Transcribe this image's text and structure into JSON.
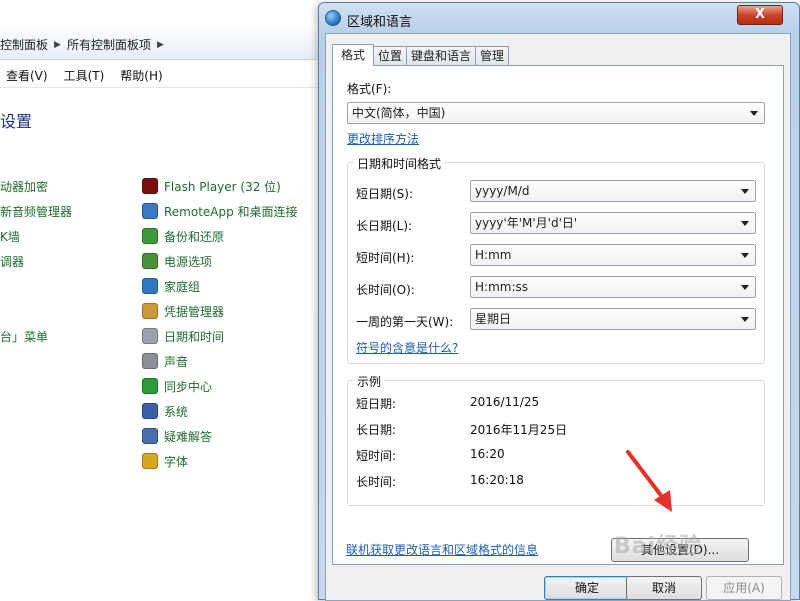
{
  "control_panel": {
    "breadcrumb": [
      "控制面板",
      "所有控制面板项"
    ],
    "menu": [
      "查看(V)",
      "工具(T)",
      "帮助(H)"
    ],
    "title": "设置",
    "left_items": [
      "动器加密",
      "新音频管理器",
      "K墙",
      "调器",
      "台」菜单"
    ],
    "right_items": [
      {
        "label": "Flash Player (32 位)",
        "icon": "flash-icon",
        "color": "#7a1010"
      },
      {
        "label": "RemoteApp 和桌面连接",
        "icon": "remote-desktop-icon",
        "color": "#3a78c3"
      },
      {
        "label": "备份和还原",
        "icon": "backup-icon",
        "color": "#3f9a3b"
      },
      {
        "label": "电源选项",
        "icon": "power-icon",
        "color": "#4e8f3a"
      },
      {
        "label": "家庭组",
        "icon": "homegroup-icon",
        "color": "#2f78c0"
      },
      {
        "label": "凭据管理器",
        "icon": "credential-icon",
        "color": "#c89a3a"
      },
      {
        "label": "日期和时间",
        "icon": "clock-icon",
        "color": "#9aa3ad"
      },
      {
        "label": "声音",
        "icon": "speaker-icon",
        "color": "#8b8f96"
      },
      {
        "label": "同步中心",
        "icon": "sync-icon",
        "color": "#2c9a3a"
      },
      {
        "label": "系统",
        "icon": "system-icon",
        "color": "#3a5fa8"
      },
      {
        "label": "疑难解答",
        "icon": "troubleshoot-icon",
        "color": "#4a6fb0"
      },
      {
        "label": "字体",
        "icon": "font-icon",
        "color": "#d9a520"
      }
    ]
  },
  "dialog": {
    "title": "区域和语言",
    "close_label": "X",
    "tabs": [
      "格式",
      "位置",
      "键盘和语言",
      "管理"
    ],
    "format_label": "格式(F):",
    "format_value": "中文(简体，中国)",
    "sort_link": "更改排序方法",
    "datetime_group_title": "日期和时间格式",
    "fields": [
      {
        "label": "短日期(S):",
        "value": "yyyy/M/d"
      },
      {
        "label": "长日期(L):",
        "value": "yyyy'年'M'月'd'日'"
      },
      {
        "label": "短时间(H):",
        "value": "H:mm"
      },
      {
        "label": "长时间(O):",
        "value": "H:mm:ss"
      },
      {
        "label": "一周的第一天(W):",
        "value": "星期日"
      }
    ],
    "symbols_link": "符号的含意是什么?",
    "example_group_title": "示例",
    "examples": [
      {
        "label": "短日期:",
        "value": "2016/11/25"
      },
      {
        "label": "长日期:",
        "value": "2016年11月25日"
      },
      {
        "label": "短时间:",
        "value": "16:20"
      },
      {
        "label": "长时间:",
        "value": "16:20:18"
      }
    ],
    "other_settings_button": "其他设置(D)...",
    "online_info_link": "联机获取更改语言和区域格式的信息",
    "ok_button": "确定",
    "cancel_button": "取消",
    "apply_button": "应用(A)"
  },
  "watermark": "Bai经验",
  "colors": {
    "link_blue": "#1e5fb0",
    "cp_green": "#1f6c2e",
    "arrow_red": "#e8302a"
  }
}
